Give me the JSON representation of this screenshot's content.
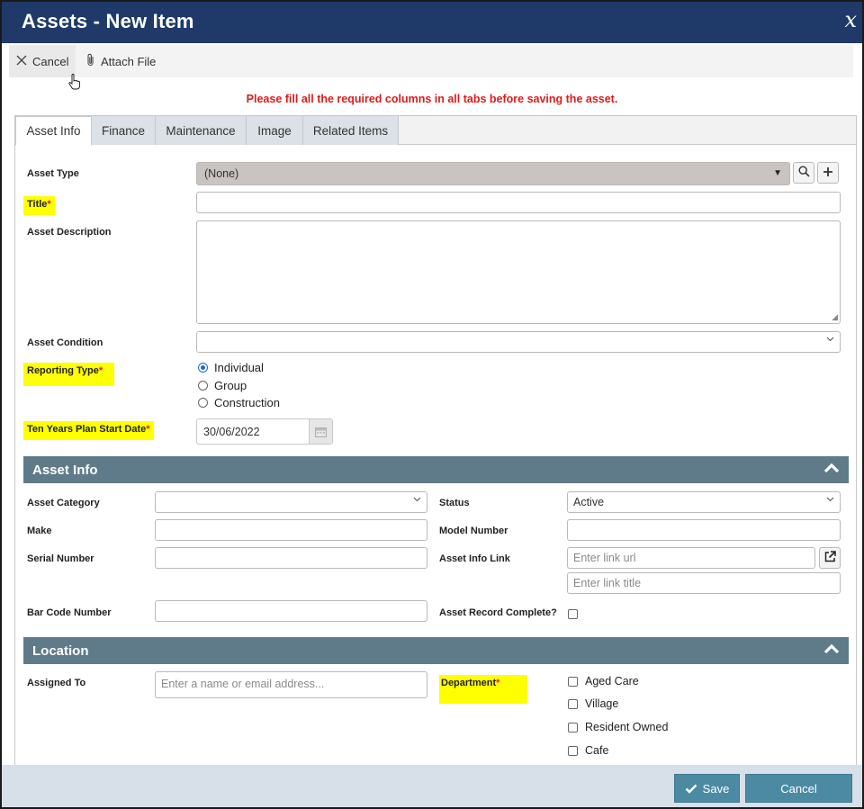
{
  "window": {
    "title": "Assets - New Item",
    "close_glyph": "x"
  },
  "toolbar": {
    "cancel_label": "Cancel",
    "attach_label": "Attach File"
  },
  "notice": "Please fill all the required columns in all tabs before saving the asset.",
  "tabs": [
    {
      "label": "Asset Info",
      "active": true
    },
    {
      "label": "Finance",
      "active": false
    },
    {
      "label": "Maintenance",
      "active": false
    },
    {
      "label": "Image",
      "active": false
    },
    {
      "label": "Related Items",
      "active": false
    }
  ],
  "form": {
    "asset_type": {
      "label": "Asset Type",
      "value": "(None)"
    },
    "title": {
      "label": "Title",
      "value": ""
    },
    "asset_description": {
      "label": "Asset Description",
      "value": ""
    },
    "asset_condition": {
      "label": "Asset Condition",
      "value": ""
    },
    "reporting_type": {
      "label": "Reporting Type",
      "options": [
        "Individual",
        "Group",
        "Construction"
      ],
      "selected": "Individual"
    },
    "ten_years_plan": {
      "label": "Ten Years Plan Start Date",
      "value": "30/06/2022"
    },
    "required_mark": "*"
  },
  "asset_info_section": {
    "title": "Asset Info",
    "asset_category": {
      "label": "Asset Category",
      "value": ""
    },
    "status": {
      "label": "Status",
      "value": "Active"
    },
    "make": {
      "label": "Make",
      "value": ""
    },
    "model_number": {
      "label": "Model Number",
      "value": ""
    },
    "serial_number": {
      "label": "Serial Number",
      "value": ""
    },
    "asset_info_link": {
      "label": "Asset Info Link",
      "url_placeholder": "Enter link url",
      "title_placeholder": "Enter link title"
    },
    "bar_code_number": {
      "label": "Bar Code Number",
      "value": ""
    },
    "asset_record_complete": {
      "label": "Asset Record Complete?",
      "checked": false
    }
  },
  "location_section": {
    "title": "Location",
    "assigned_to": {
      "label": "Assigned To",
      "placeholder": "Enter a name or email address..."
    },
    "department": {
      "label": "Department",
      "options": [
        "Aged Care",
        "Village",
        "Resident Owned",
        "Cafe"
      ]
    }
  },
  "footer": {
    "save_label": "Save",
    "cancel_label": "Cancel"
  },
  "colors": {
    "header_bg": "#1f3a68",
    "section_bg": "#5f7b89",
    "required": "#e01a1a",
    "highlight": "#ffff00",
    "button_bg": "#4c8aa3"
  }
}
